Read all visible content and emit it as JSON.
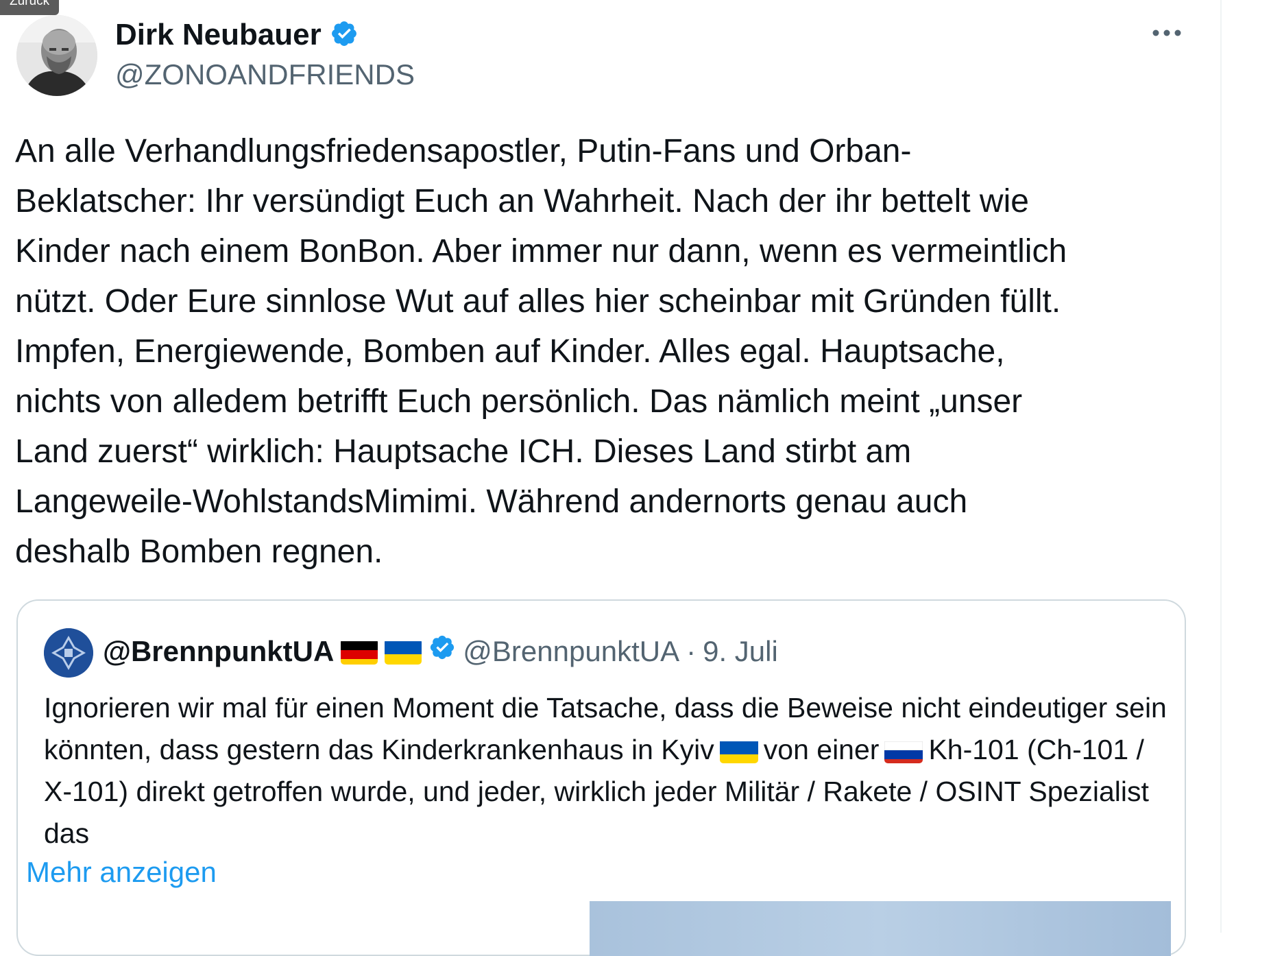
{
  "tooltip": {
    "label": "Zurück"
  },
  "author": {
    "display_name": "Dirk Neubauer",
    "handle": "@ZONOANDFRIENDS",
    "verified": true,
    "verified_color": "#1d9bf0"
  },
  "tweet": {
    "text": "An alle Verhandlungsfriedensapostler, Putin-Fans und Orban-\nBeklatscher: Ihr versündigt Euch an Wahrheit. Nach der ihr bettelt wie\nKinder nach einem BonBon. Aber immer nur dann, wenn es vermeintlich\nnützt. Oder Eure sinnlose Wut auf alles hier scheinbar mit Gründen füllt.\nImpfen, Energiewende, Bomben auf Kinder. Alles egal. Hauptsache,\nnichts von alledem betrifft Euch persönlich. Das nämlich meint „unser\nLand zuerst“ wirklich: Hauptsache ICH. Dieses Land stirbt am\nLangeweile-WohlstandsMimimi. Während andernorts genau auch\ndeshalb Bomben regnen."
  },
  "quote": {
    "display_name": "@BrennpunktUA",
    "handle": "@BrennpunktUA",
    "separator": "·",
    "date": "9. Juli",
    "text_1": "Ignorieren wir mal für einen Moment die Tatsache, dass die Beweise nicht eindeutiger sein könnten, dass gestern das Kinderkrankenhaus in Kyiv",
    "text_2": "von einer",
    "text_3": "Kh-101 (Ch-101 / X-101) direkt getroffen wurde, und jeder, wirklich jeder Militär / Rakete / OSINT Spezialist das",
    "show_more": "Mehr anzeigen"
  },
  "icons": {
    "more": "more-horizontal-icon",
    "verified": "verified-badge-icon",
    "flags": [
      "flag-germany-icon",
      "flag-ukraine-icon",
      "flag-russia-icon"
    ]
  },
  "colors": {
    "text": "#0f1419",
    "secondary": "#536471",
    "link": "#1d9bf0",
    "border": "#cfd9de"
  }
}
